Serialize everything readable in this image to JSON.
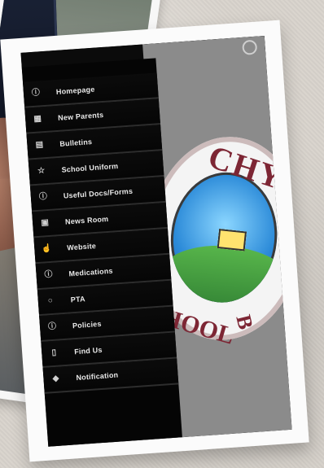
{
  "menu": {
    "items": [
      {
        "label": "Homepage",
        "icon": "info-icon"
      },
      {
        "label": "New Parents",
        "icon": "grid-icon"
      },
      {
        "label": "Bulletins",
        "icon": "document-icon"
      },
      {
        "label": "School Uniform",
        "icon": "star-icon"
      },
      {
        "label": "Useful Docs/Forms",
        "icon": "info-icon"
      },
      {
        "label": "News Room",
        "icon": "image-icon"
      },
      {
        "label": "Website",
        "icon": "pointer-icon"
      },
      {
        "label": "Medications",
        "icon": "info-icon"
      },
      {
        "label": "PTA",
        "icon": "chat-icon"
      },
      {
        "label": "Policies",
        "icon": "info-icon"
      },
      {
        "label": "Find Us",
        "icon": "phone-icon"
      },
      {
        "label": "Notification",
        "icon": "tag-icon"
      }
    ]
  },
  "logo": {
    "top_text": "CHY",
    "right_text": "B",
    "bottom_text": "HOOL"
  }
}
